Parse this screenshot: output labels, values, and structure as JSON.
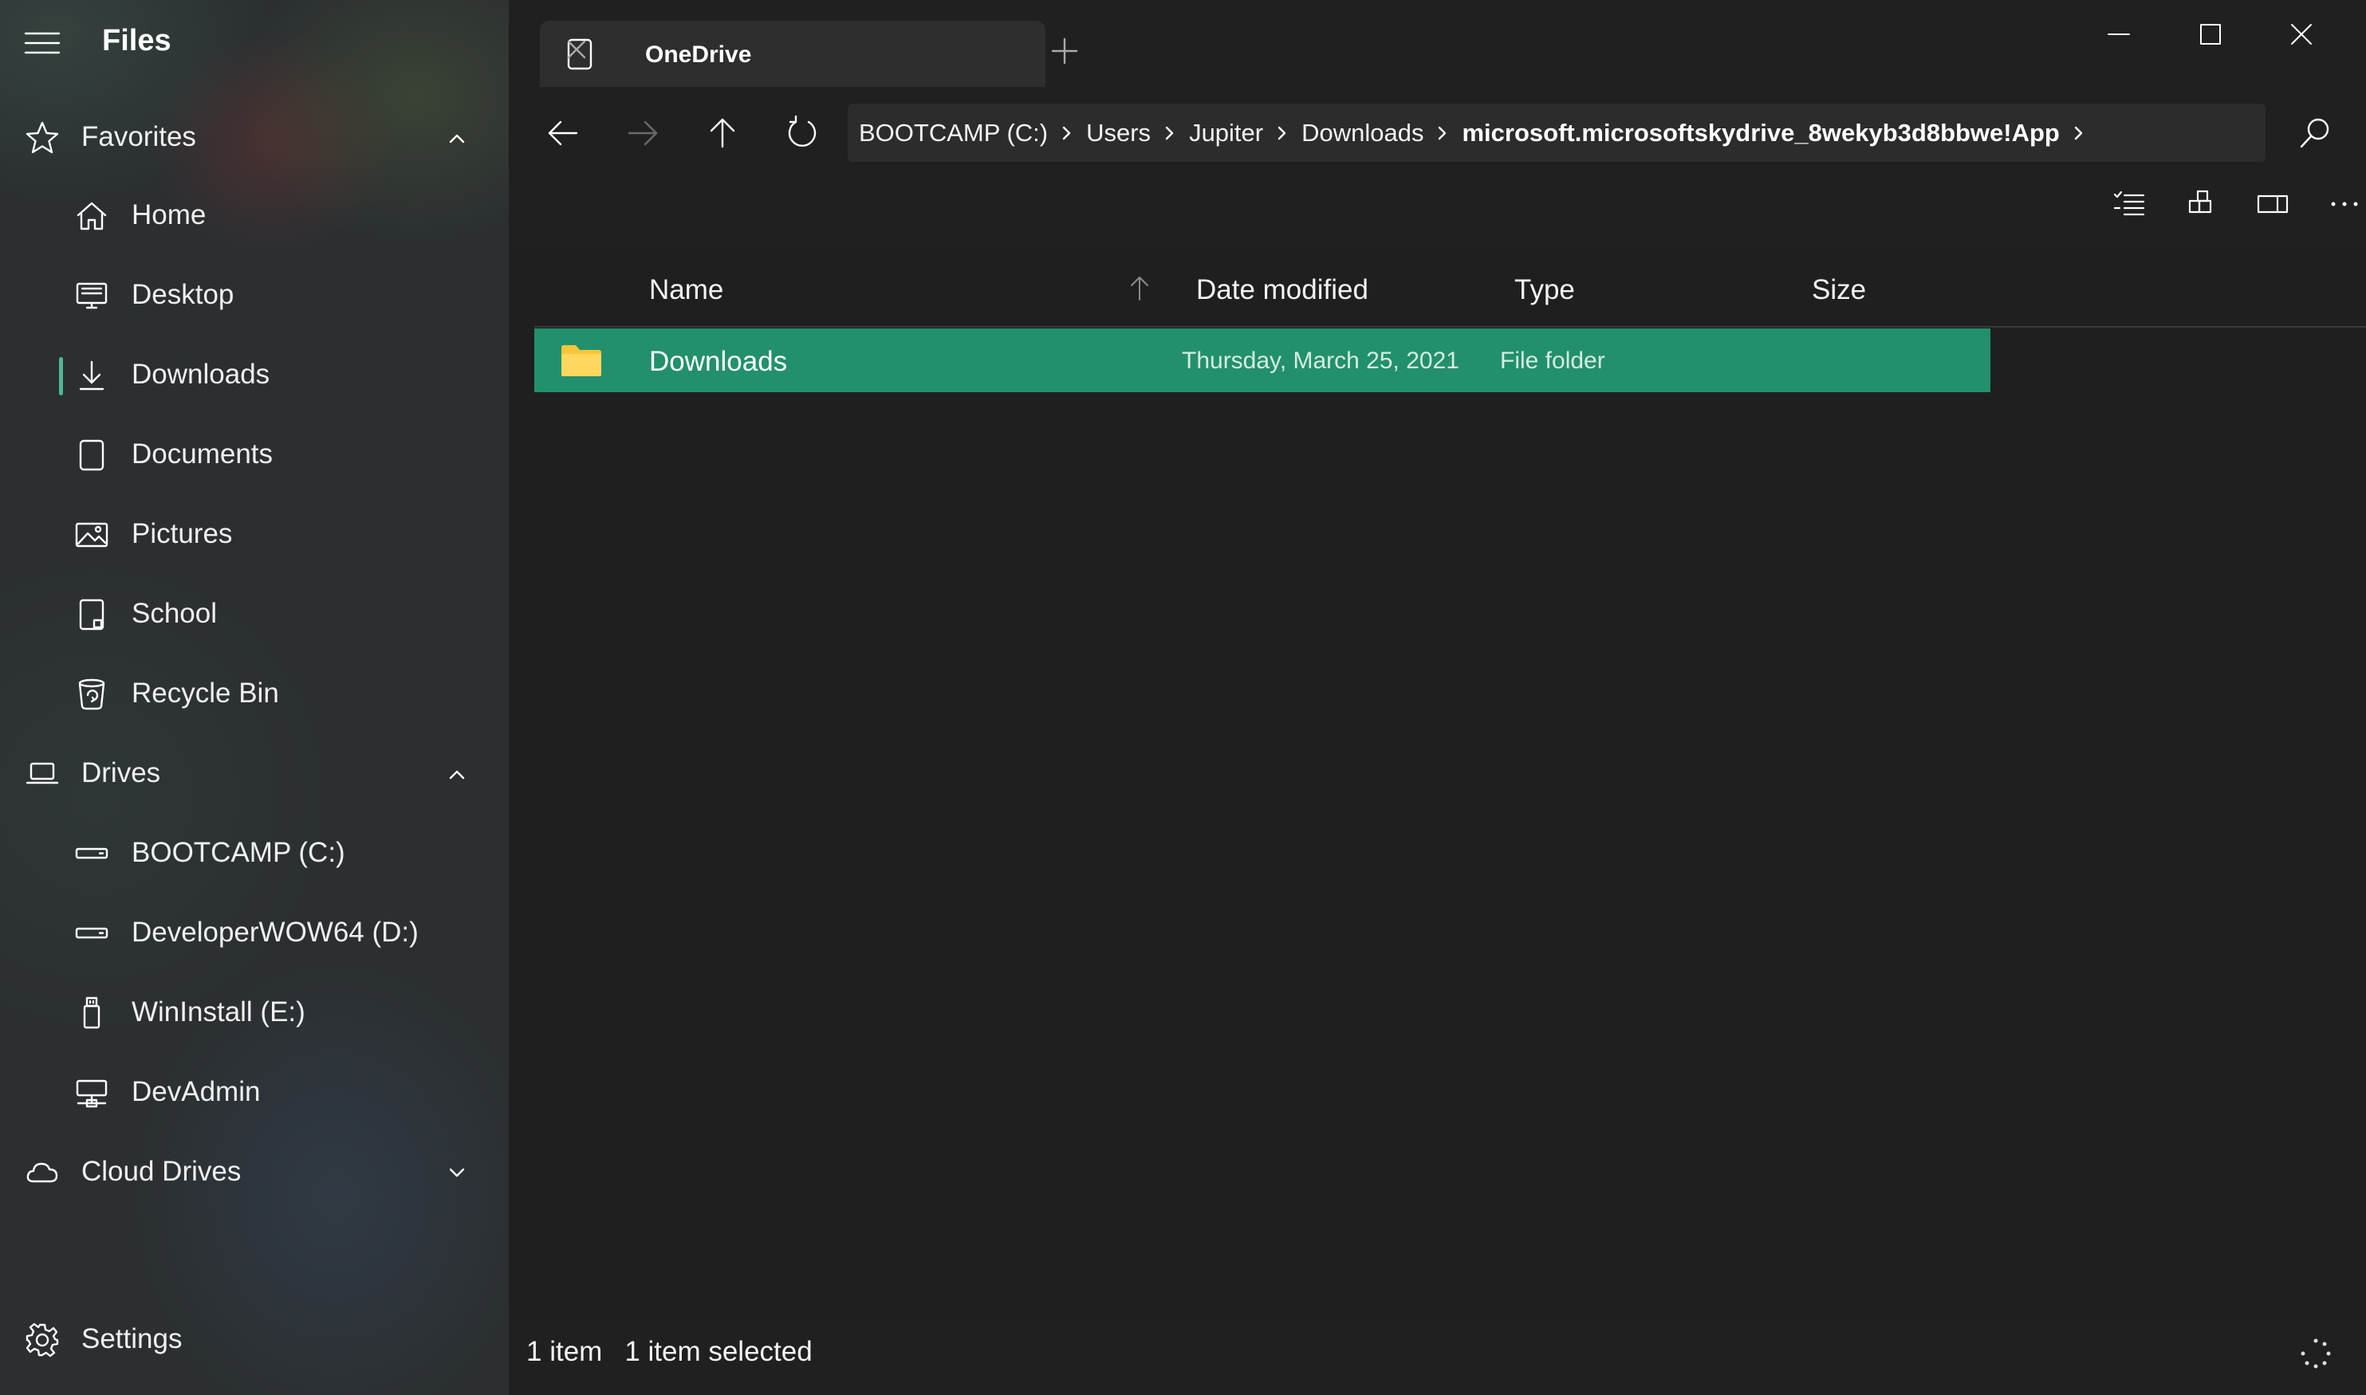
{
  "app": {
    "title": "Files"
  },
  "sidebar": {
    "favorites": {
      "label": "Favorites",
      "items": [
        {
          "label": "Home",
          "icon": "home-icon"
        },
        {
          "label": "Desktop",
          "icon": "desktop-icon"
        },
        {
          "label": "Downloads",
          "icon": "download-icon",
          "selected": true
        },
        {
          "label": "Documents",
          "icon": "document-icon"
        },
        {
          "label": "Pictures",
          "icon": "picture-icon"
        },
        {
          "label": "School",
          "icon": "folder-pinned-icon"
        },
        {
          "label": "Recycle Bin",
          "icon": "recycle-bin-icon"
        }
      ]
    },
    "drives": {
      "label": "Drives",
      "items": [
        {
          "label": "BOOTCAMP (C:)",
          "icon": "drive-icon"
        },
        {
          "label": "DeveloperWOW64 (D:)",
          "icon": "drive-icon"
        },
        {
          "label": "WinInstall (E:)",
          "icon": "usb-drive-icon"
        },
        {
          "label": "DevAdmin",
          "icon": "network-drive-icon"
        }
      ]
    },
    "cloud_drives": {
      "label": "Cloud Drives"
    },
    "settings": {
      "label": "Settings"
    }
  },
  "tabs": [
    {
      "label": "OneDrive",
      "active": true
    }
  ],
  "breadcrumb": [
    "BOOTCAMP (C:)",
    "Users",
    "Jupiter",
    "Downloads",
    "microsoft.microsoftskydrive_8wekyb3d8bbwe!App"
  ],
  "columns": {
    "name": "Name",
    "date_modified": "Date modified",
    "type": "Type",
    "size": "Size"
  },
  "files": [
    {
      "name": "Downloads",
      "date_modified": "Thursday, March 25, 2021",
      "type": "File folder",
      "size": "",
      "selected": true
    }
  ],
  "status": {
    "item_count": "1 item",
    "selection": "1 item selected"
  },
  "colors": {
    "accent": "#22906c",
    "selection_indicator": "#4db897",
    "folder": "#f8c53a",
    "background": "#202020"
  }
}
